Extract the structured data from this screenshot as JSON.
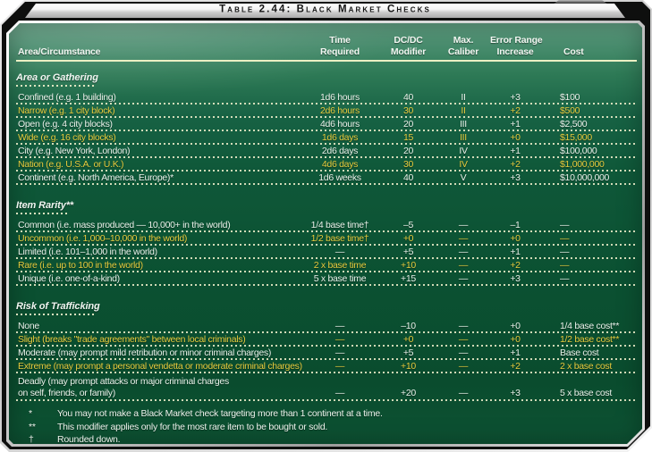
{
  "title": "Table 2.44: Black Market Checks",
  "colors": {
    "panel_green_top": "#4a8e6f",
    "panel_green": "#0b5132",
    "row_text_white": "#e9f2ea",
    "row_text_yellow": "#e6cb3e",
    "dotted_line": "#f3f1cd",
    "header_rule": "#ecf0c4",
    "frame_black": "#0e0f0e",
    "titlebar_silver": "#d6d6d6"
  },
  "table": {
    "headers": [
      {
        "line1": "",
        "line2": "Area/Circumstance"
      },
      {
        "line1": "Time",
        "line2": "Required"
      },
      {
        "line1": "DC/DC",
        "line2": "Modifier"
      },
      {
        "line1": "Max.",
        "line2": "Caliber"
      },
      {
        "line1": "Error Range",
        "line2": "Increase"
      },
      {
        "line1": "",
        "line2": "Cost"
      }
    ],
    "sections": [
      {
        "title": "Area or Gathering",
        "rows": [
          {
            "highlight": false,
            "cells": [
              "Confined (e.g. 1 building)",
              "1d6 hours",
              "40",
              "II",
              "+3",
              "$100"
            ]
          },
          {
            "highlight": true,
            "cells": [
              "Narrow (e.g. 1 city block)",
              "2d6 hours",
              "30",
              "II",
              "+2",
              "$500"
            ]
          },
          {
            "highlight": false,
            "cells": [
              "Open (e.g. 4 city blocks)",
              "4d6 hours",
              "20",
              "III",
              "+1",
              "$2,500"
            ]
          },
          {
            "highlight": true,
            "cells": [
              "Wide (e.g. 16 city blocks)",
              "1d6 days",
              "15",
              "III",
              "+0",
              "$15,000"
            ]
          },
          {
            "highlight": false,
            "cells": [
              "City (e.g. New York, London)",
              "2d6 days",
              "20",
              "IV",
              "+1",
              "$100,000"
            ]
          },
          {
            "highlight": true,
            "cells": [
              "Nation (e.g. U.S.A. or U.K.)",
              "4d6 days",
              "30",
              "IV",
              "+2",
              "$1,000,000"
            ]
          },
          {
            "highlight": false,
            "cells": [
              "Continent (e.g. North America, Europe)*",
              "1d6 weeks",
              "40",
              "V",
              "+3",
              "$10,000,000"
            ]
          }
        ]
      },
      {
        "title": "Item Rarity**",
        "rows": [
          {
            "highlight": false,
            "cells": [
              "Common (i.e. mass produced — 10,000+ in the world)",
              "1/4 base time†",
              "–5",
              "—",
              "–1",
              "—"
            ]
          },
          {
            "highlight": true,
            "cells": [
              "Uncommon (i.e. 1,000–10,000 in the world)",
              "1/2 base time†",
              "+0",
              "—",
              "+0",
              "—"
            ]
          },
          {
            "highlight": false,
            "cells": [
              "Limited (i.e. 101–1,000 in the world)",
              "—",
              "+5",
              "—",
              "+1",
              "—"
            ]
          },
          {
            "highlight": true,
            "cells": [
              "Rare (i.e. up to 100 in the world)",
              "2 x base time",
              "+10",
              "—",
              "+2",
              "—"
            ]
          },
          {
            "highlight": false,
            "cells": [
              "Unique (i.e. one-of-a-kind)",
              "5 x base time",
              "+15",
              "—",
              "+3",
              "—"
            ]
          }
        ]
      },
      {
        "title": "Risk of Trafficking",
        "rows": [
          {
            "highlight": false,
            "cells": [
              "None",
              "—",
              "–10",
              "—",
              "+0",
              "1/4 base cost**"
            ]
          },
          {
            "highlight": true,
            "cells": [
              "Slight (breaks \"trade agreements\" between local criminals)",
              "—",
              "+0",
              "—",
              "+0",
              "1/2 base cost**"
            ]
          },
          {
            "highlight": false,
            "cells": [
              "Moderate (may prompt mild retribution or minor criminal charges)",
              "—",
              "+5",
              "—",
              "+1",
              "Base cost"
            ]
          },
          {
            "highlight": true,
            "cells": [
              "Extreme (may prompt a personal vendetta or moderate criminal charges)",
              "—",
              "+10",
              "—",
              "+2",
              "2 x base cost"
            ]
          },
          {
            "highlight": false,
            "cells": [
              "Deadly (may prompt attacks or major criminal charges",
              "—",
              "+20",
              "—",
              "+3",
              "5 x base cost"
            ],
            "label_line2": "on self, friends, or family)"
          }
        ]
      }
    ],
    "footnotes": [
      {
        "marker": "*",
        "text": "You may not make a Black Market check targeting more than 1 continent at a time."
      },
      {
        "marker": "**",
        "text": "This modifier applies only for the most rare item to be bought or sold."
      },
      {
        "marker": "†",
        "text": "Rounded down."
      }
    ]
  }
}
